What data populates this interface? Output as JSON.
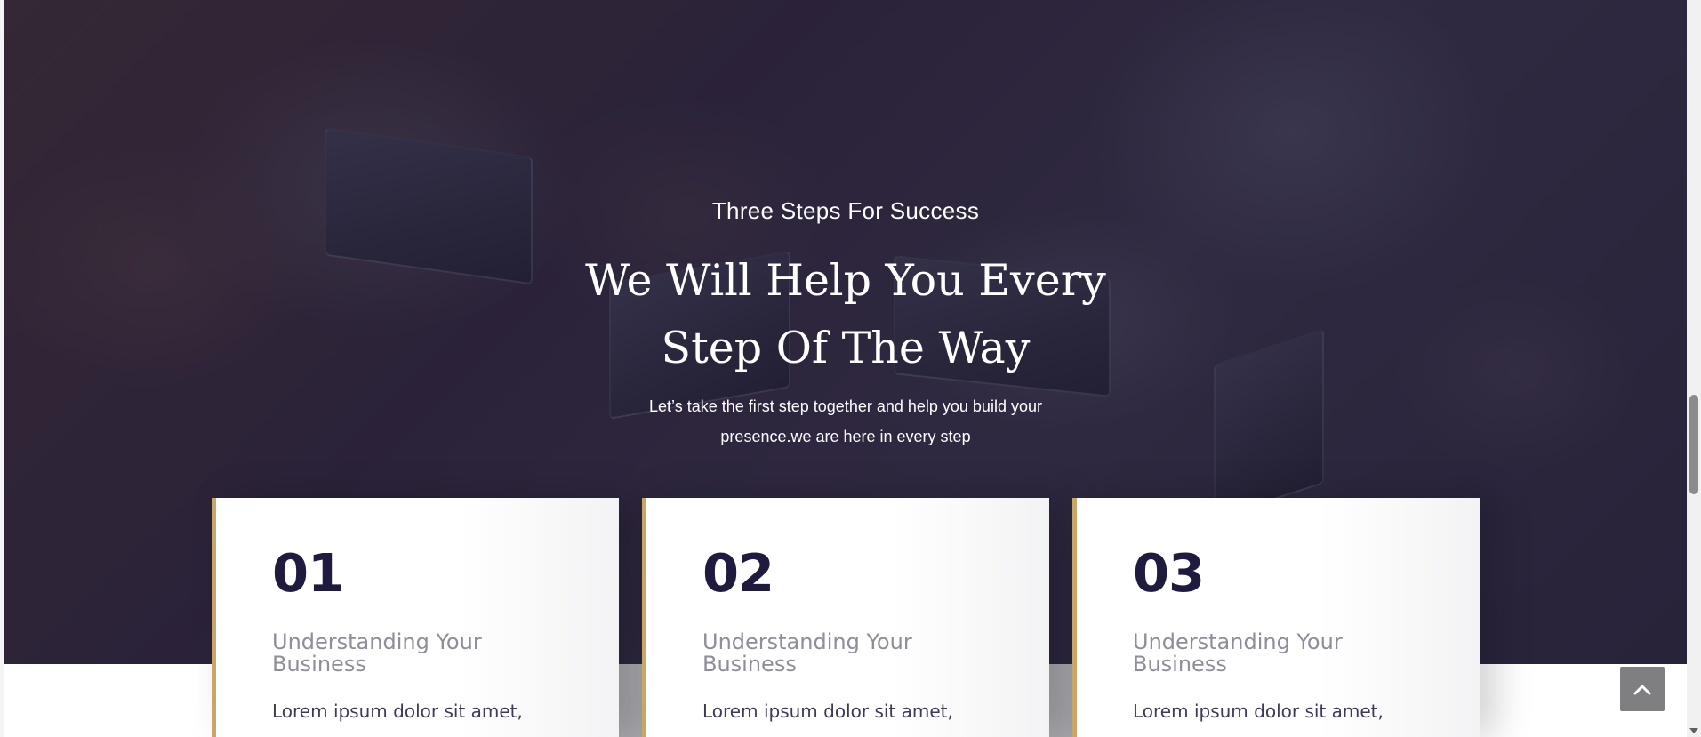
{
  "hero": {
    "eyebrow": "Three Steps For Success",
    "headline_line1": "We Will Help You Every",
    "headline_line2": "Step Of The Way",
    "subtext_line1": "Let’s take the first step together and help you build your",
    "subtext_line2": "presence.we are here in every step"
  },
  "steps": [
    {
      "number": "01",
      "title": "Understanding Your Business",
      "body": "Lorem ipsum dolor sit amet,"
    },
    {
      "number": "02",
      "title": "Understanding Your Business",
      "body": "Lorem ipsum dolor sit amet,"
    },
    {
      "number": "03",
      "title": "Understanding Your Business",
      "body": "Lorem ipsum dolor sit amet,"
    }
  ],
  "controls": {
    "scroll_top_icon": "chevron-up-icon"
  },
  "colors": {
    "accent_gold": "#c8a66a",
    "navy": "#1e1b3f",
    "overlay": "#1e1834"
  }
}
